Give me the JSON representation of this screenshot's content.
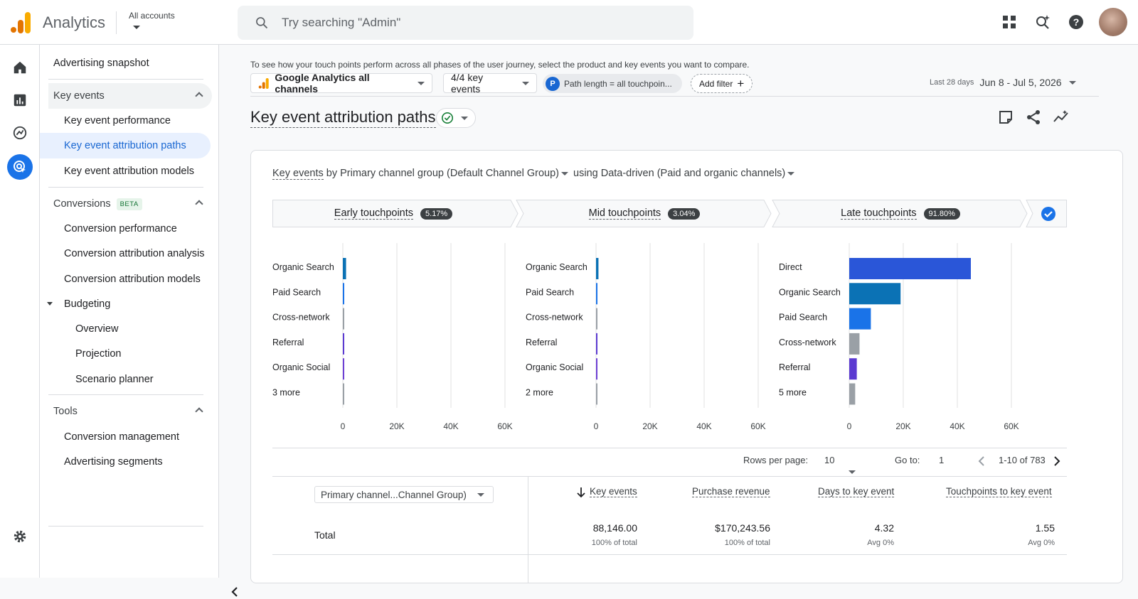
{
  "header": {
    "app_title": "Analytics",
    "account_label": "All accounts",
    "search_placeholder": "Try searching \"Admin\"",
    "icons": [
      "apps-grid-icon",
      "search-insights-icon",
      "help-icon",
      "avatar"
    ]
  },
  "rail": {
    "items": [
      "home-icon",
      "reports-icon",
      "explore-icon",
      "advertising-icon"
    ],
    "active": "advertising-icon",
    "bottom": "settings-icon"
  },
  "nav": {
    "top_item": "Advertising snapshot",
    "key_events_header": "Key events",
    "key_events_items": [
      "Key event performance",
      "Key event attribution paths",
      "Key event attribution models"
    ],
    "selected": "Key event attribution paths",
    "conversions_header": "Conversions",
    "beta": "BETA",
    "conversions_items": [
      "Conversion performance",
      "Conversion attribution analysis",
      "Conversion attribution models"
    ],
    "budgeting_header": "Budgeting",
    "budgeting_items": [
      "Overview",
      "Projection",
      "Scenario planner"
    ],
    "tools_header": "Tools",
    "tools_items": [
      "Conversion management",
      "Advertising segments"
    ]
  },
  "filters": {
    "hint": "To see how your touch points perform across all phases of the user journey, select the product and key events you want to compare.",
    "product": "Google Analytics all channels",
    "events": "4/4 key events",
    "chip_letter": "P",
    "chip_label": "Path length = all touchpoin...",
    "add_filter": "Add filter",
    "last_28": "Last 28 days",
    "range": "Jun 8 - Jul 5, 2026"
  },
  "page_title": "Key event attribution paths",
  "controls": {
    "metric": "Key events",
    "by": " by Primary channel group (Default Channel Group)",
    "using": " using Data-driven (Paid and organic channels)"
  },
  "phases": [
    {
      "label": "Early touchpoints",
      "pct": "5.17%"
    },
    {
      "label": "Mid touchpoints",
      "pct": "3.04%"
    },
    {
      "label": "Late touchpoints",
      "pct": "91.80%"
    }
  ],
  "colors": {
    "direct": "#2a56d8",
    "organic_search": "#0b72b5",
    "paid_search": "#1a73e8",
    "cross_network": "#9aa0a6",
    "referral": "#5b3ad1",
    "organic_social": "#6d3fd4",
    "more": "#9aa0a6"
  },
  "chart_data": [
    {
      "type": "bar",
      "orientation": "horizontal",
      "categories": [
        "Organic Search",
        "Paid Search",
        "Cross-network",
        "Referral",
        "Organic Social",
        "3 more"
      ],
      "values": [
        1200,
        400,
        300,
        200,
        150,
        100
      ],
      "xticks": [
        "0",
        "20K",
        "40K",
        "60K"
      ],
      "xlim": [
        0,
        60000
      ]
    },
    {
      "type": "bar",
      "orientation": "horizontal",
      "categories": [
        "Organic Search",
        "Paid Search",
        "Cross-network",
        "Referral",
        "Organic Social",
        "2 more"
      ],
      "values": [
        900,
        200,
        150,
        120,
        80,
        60
      ],
      "xticks": [
        "0",
        "20K",
        "40K",
        "60K"
      ],
      "xlim": [
        0,
        60000
      ]
    },
    {
      "type": "bar",
      "orientation": "horizontal",
      "categories": [
        "Direct",
        "Organic Search",
        "Paid Search",
        "Cross-network",
        "Referral",
        "5 more"
      ],
      "values": [
        45000,
        19000,
        8000,
        3800,
        2800,
        2200
      ],
      "xticks": [
        "0",
        "20K",
        "40K",
        "60K"
      ],
      "xlim": [
        0,
        60000
      ]
    }
  ],
  "pager": {
    "rows_label": "Rows per page:",
    "rows_value": "10",
    "goto_label": "Go to:",
    "goto_value": "1",
    "range": "1-10 of 783"
  },
  "table": {
    "dimension": "Primary channel...Channel Group)",
    "headers": [
      "Key events",
      "Purchase revenue",
      "Days to key event",
      "Touchpoints to key event"
    ],
    "total_label": "Total",
    "totals": [
      "88,146.00",
      "$170,243.56",
      "4.32",
      "1.55"
    ],
    "totals_sub": [
      "100% of total",
      "100% of total",
      "Avg 0%",
      "Avg 0%"
    ]
  }
}
